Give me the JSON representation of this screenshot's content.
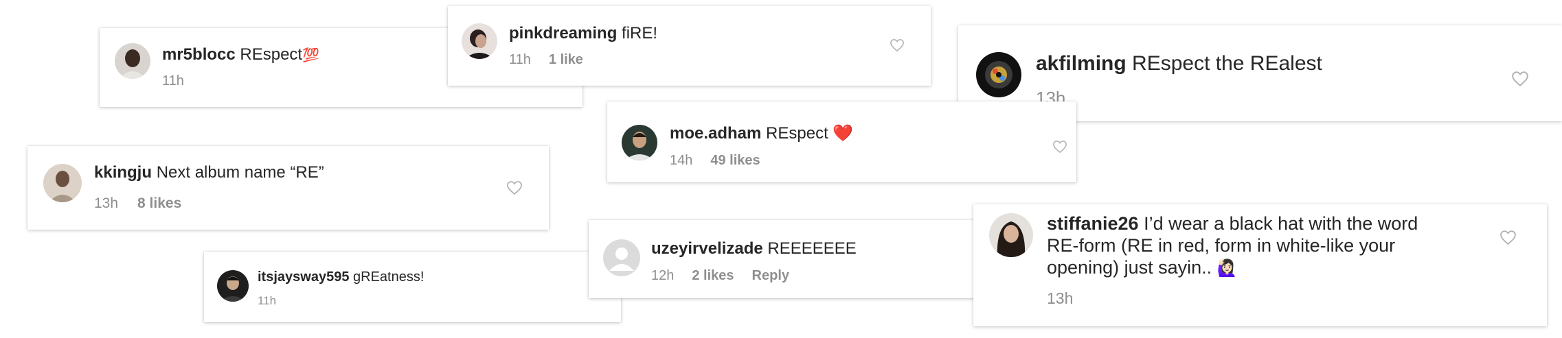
{
  "comments": [
    {
      "username": "mr5blocc",
      "text": "REspect",
      "emoji": "💯",
      "time": "11h"
    },
    {
      "username": "pinkdreaming",
      "text": "fiRE!",
      "time": "11h",
      "likes": "1 like"
    },
    {
      "username": "akfilming",
      "text": "REspect the REalest",
      "time": "13h"
    },
    {
      "username": "moe.adham",
      "text": "REspect",
      "emoji": "❤️",
      "time": "14h",
      "likes": "49 likes"
    },
    {
      "username": "kkingju",
      "text": "Next album name “RE”",
      "time": "13h",
      "likes": "8 likes"
    },
    {
      "username": "itsjaysway595",
      "text": "gREatness!",
      "time": "11h"
    },
    {
      "username": "uzeyirvelizade",
      "text": "REEEEEEE",
      "time": "12h",
      "likes": "2 likes",
      "reply": "Reply"
    },
    {
      "username": "stiffanie26",
      "text_line1": "I’d wear a black hat with the word",
      "text_line2": "RE-form (RE in red, form in white-like your",
      "text_line3": "opening) just sayin..",
      "emoji": "🙋🏻‍♀️",
      "time": "13h"
    }
  ],
  "icons": {
    "like": "heart-outline-icon",
    "default_avatar": "default-avatar-icon"
  },
  "colors": {
    "text": "#262626",
    "meta": "#8e8e8e",
    "icon": "#b3b3b3",
    "heart_emoji": "#e0245e",
    "hundred_emoji": "#e53935"
  }
}
